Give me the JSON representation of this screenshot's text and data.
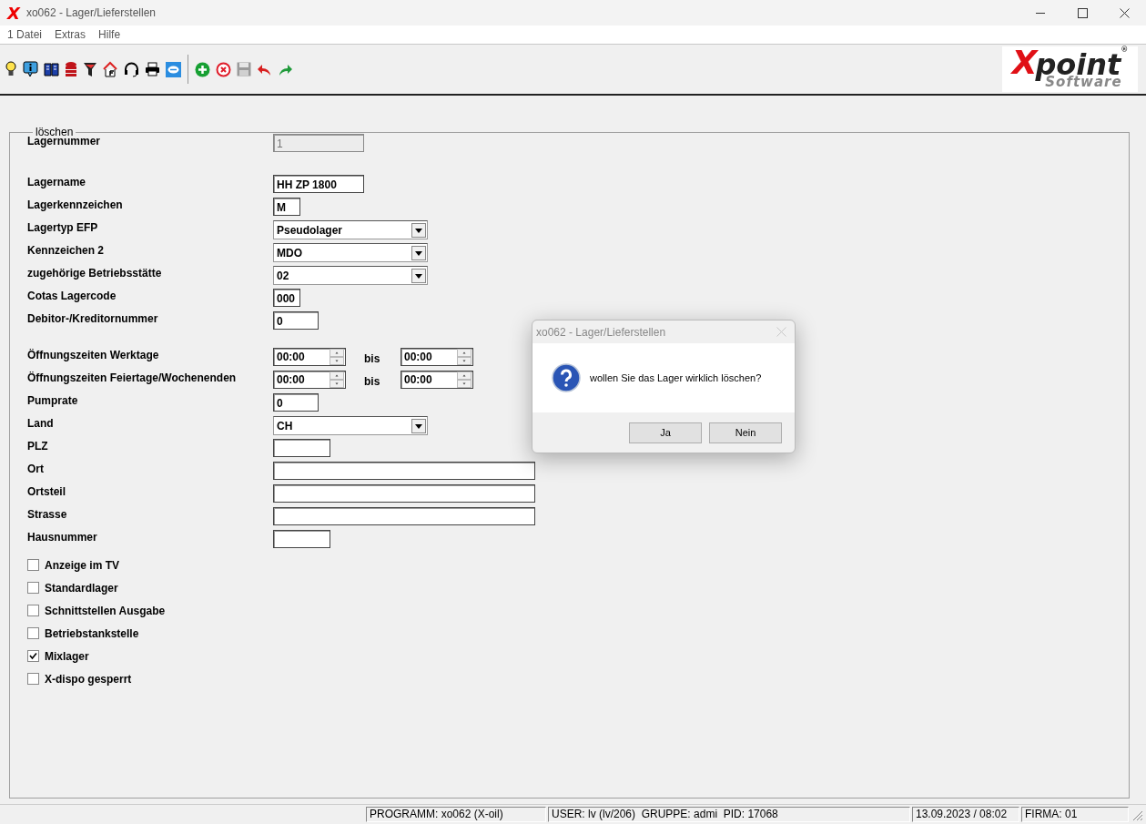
{
  "window": {
    "title": "xo062 - Lager/Lieferstellen",
    "icon_letter": "X"
  },
  "menu": [
    "1 Datei",
    "Extras",
    "Hilfe"
  ],
  "logo": {
    "letter": "X",
    "word": "point",
    "mark": "®",
    "subtitle": "Software"
  },
  "form": {
    "legend": "löschen",
    "rows": [
      {
        "kind": "text",
        "label": "Lagernummer",
        "value": "1",
        "disabled": true
      },
      {
        "kind": "gap"
      },
      {
        "kind": "text",
        "label": "Lagername",
        "value": "HH ZP 1800",
        "disabled": false
      },
      {
        "kind": "text",
        "label": "Lagerkennzeichen",
        "value": "M",
        "disabled": false
      },
      {
        "kind": "select",
        "label": "Lagertyp EFP",
        "value": "Pseudolager",
        "disabled": false
      },
      {
        "kind": "select",
        "label": "Kennzeichen 2",
        "value": "MDO",
        "disabled": false
      },
      {
        "kind": "select",
        "label": "zugehörige Betriebsstätte",
        "value": "02",
        "disabled": false
      },
      {
        "kind": "text",
        "label": "Cotas Lagercode",
        "value": "000",
        "disabled": false
      },
      {
        "kind": "text",
        "label": "Debitor-/Kreditornummer",
        "value": "0",
        "disabled": false
      },
      {
        "kind": "gap"
      },
      {
        "kind": "time",
        "label": "Öffnungszeiten Werktage",
        "from": "00:00",
        "separator": "bis",
        "to": "00:00",
        "disabled": false
      },
      {
        "kind": "time",
        "label": "Öffnungszeiten Feiertage/Wochenenden",
        "from": "00:00",
        "separator": "bis",
        "to": "00:00",
        "disabled": false
      },
      {
        "kind": "text",
        "label": "Pumprate",
        "value": "0",
        "disabled": false
      },
      {
        "kind": "select",
        "label": "Land",
        "value": "CH",
        "disabled": false
      },
      {
        "kind": "text",
        "label": "PLZ",
        "disabled": false
      },
      {
        "kind": "text",
        "label": "Ort",
        "disabled": false
      },
      {
        "kind": "text",
        "label": "Ortsteil",
        "disabled": false
      },
      {
        "kind": "text",
        "label": "Strasse",
        "disabled": false
      },
      {
        "kind": "text",
        "label": "Hausnummer",
        "disabled": false
      }
    ],
    "checkboxes": [
      {
        "label": "Anzeige im TV",
        "checked": false
      },
      {
        "label": "Standardlager",
        "checked": false
      },
      {
        "label": "Schnittstellen Ausgabe",
        "checked": false
      },
      {
        "label": "Betriebstankstelle",
        "checked": false
      },
      {
        "label": "Mixlager",
        "checked": true
      },
      {
        "label": "X-dispo gesperrt",
        "checked": false
      }
    ]
  },
  "dialog": {
    "title": "xo062 - Lager/Lieferstellen",
    "message": "wollen Sie das Lager wirklich löschen?",
    "buttons": [
      "Ja",
      "Nein"
    ]
  },
  "status_bar": [
    "PROGRAMM: xo062 (X-oil)",
    "USER: lv (lv/206)  GRUPPE: admi  PID: 17068",
    "13.09.2023 / 08:02",
    "FIRMA: 01"
  ]
}
